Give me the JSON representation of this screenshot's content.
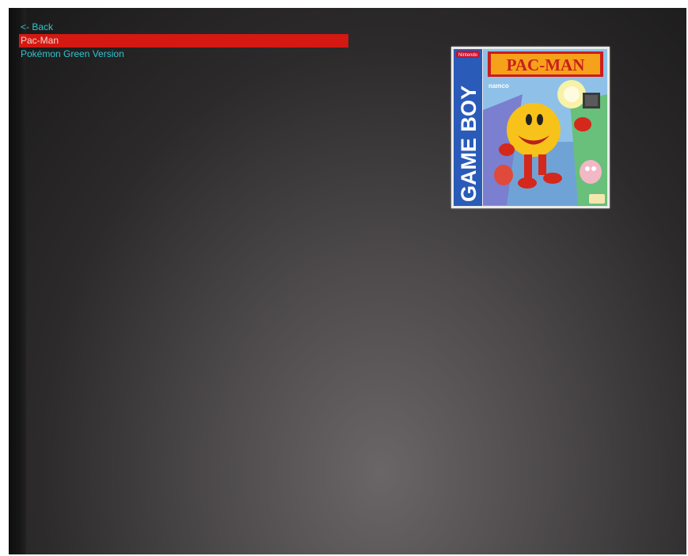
{
  "menu": {
    "items": [
      {
        "label": "<- Back",
        "selected": false
      },
      {
        "label": "Pac-Man",
        "selected": true
      },
      {
        "label": "Pokémon Green Version",
        "selected": false
      }
    ]
  },
  "cover_art": {
    "platform_text": "GAME BOY",
    "title_text": "PAC-MAN",
    "publisher_text": "namco",
    "brand_text": "Nintendo"
  },
  "colors": {
    "selection_bg": "#d41812",
    "item_text": "#2ec6cf",
    "selected_text": "#f2d8cf"
  }
}
